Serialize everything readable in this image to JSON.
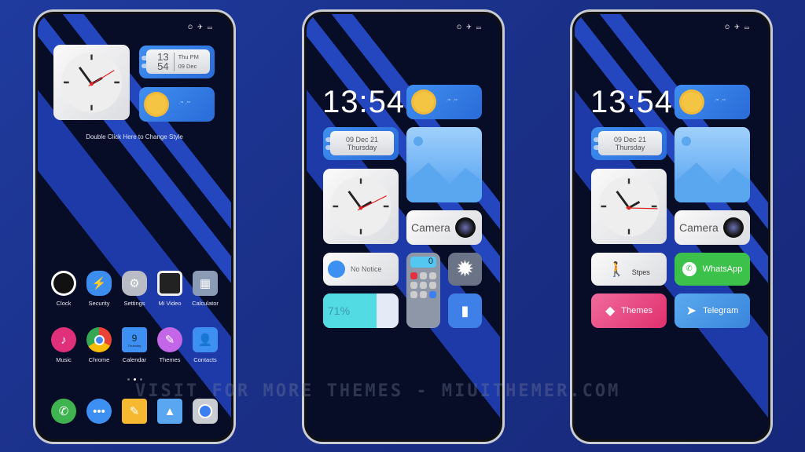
{
  "status_icons": [
    "alarm-icon",
    "airplane-icon",
    "battery-icon"
  ],
  "phone1": {
    "date_widget": {
      "hour": "13",
      "minute": "54",
      "day": "Thu PM",
      "date": "09 Dec"
    },
    "weather_text": "·'° ·'°",
    "caption": "Double Click Here to Change Style",
    "apps_row1": [
      {
        "label": "Clock",
        "color": "#111111"
      },
      {
        "label": "Security",
        "color": "#3b8ef0"
      },
      {
        "label": "Settings",
        "color": "#b9bcc4"
      },
      {
        "label": "Mi Video",
        "color": "#222222"
      },
      {
        "label": "Calculator",
        "color": "#8a9bb5"
      }
    ],
    "apps_row2": [
      {
        "label": "Music",
        "color": "#e0307a"
      },
      {
        "label": "Chrome",
        "color": "#4285f4"
      },
      {
        "label": "Calendar",
        "color": "#3d8ff2"
      },
      {
        "label": "Themes",
        "color": "#c466e8"
      },
      {
        "label": "Contacts",
        "color": "#3d8ff2"
      }
    ],
    "calendar_icon": {
      "day": "9",
      "weekday": "Thursday"
    },
    "page_indicator": {
      "pages": 3,
      "current": 2
    },
    "dock": [
      {
        "name": "phone",
        "color": "#3fb34f"
      },
      {
        "name": "messages",
        "color": "#3d8ff2"
      },
      {
        "name": "notes",
        "color": "#f5b830"
      },
      {
        "name": "gallery",
        "color": "#5aa7f0"
      },
      {
        "name": "camera",
        "color": "#c9ccd3"
      }
    ]
  },
  "phone2": {
    "time": "13:54",
    "weather_text": "·'° ·'°",
    "date": "09 Dec 21",
    "weekday": "Thursday",
    "camera_label": "Camera",
    "notice": "No Notice",
    "battery": "71%",
    "battery_level": 71,
    "calculator_value": "0"
  },
  "phone3": {
    "time": "13:54",
    "weather_text": "·'° ·'°",
    "date": "09 Dec 21",
    "weekday": "Thursday",
    "camera_label": "Camera",
    "steps": "Stpes",
    "whatsapp": "WhatsApp",
    "themes": "Themes",
    "telegram": "Telegram",
    "colors": {
      "whatsapp": "#3cc24a",
      "themes": "#e8457f",
      "telegram": "#3f8fe0"
    }
  },
  "watermark": "VISIT FOR MORE THEMES - MIUITHEMER.COM"
}
